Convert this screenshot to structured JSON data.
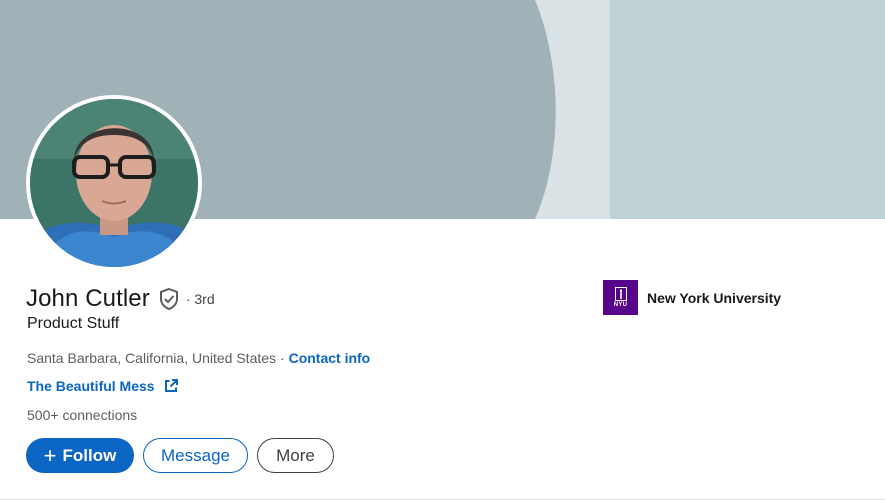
{
  "profile": {
    "name": "John Cutler",
    "degree": "· 3rd",
    "headline": "Product Stuff",
    "location": "Santa Barbara, California, United States ·",
    "contact_label": "Contact info",
    "website_label": "The Beautiful Mess",
    "connections": "500+",
    "connections_suffix": "connections"
  },
  "education": {
    "name": "New York University",
    "logo_text": "NYU"
  },
  "actions": {
    "follow_label": "Follow",
    "message_label": "Message",
    "more_label": "More"
  },
  "colors": {
    "brand_blue": "#0a66c2",
    "banner_main": "#a0b2b7",
    "banner_light": "#d9e3e5",
    "banner_right": "#bfd2d6",
    "nyu_purple": "#57068c"
  },
  "icons": {
    "verified": "verified-shield-icon",
    "external_link": "external-link-icon",
    "plus": "plus-icon"
  }
}
